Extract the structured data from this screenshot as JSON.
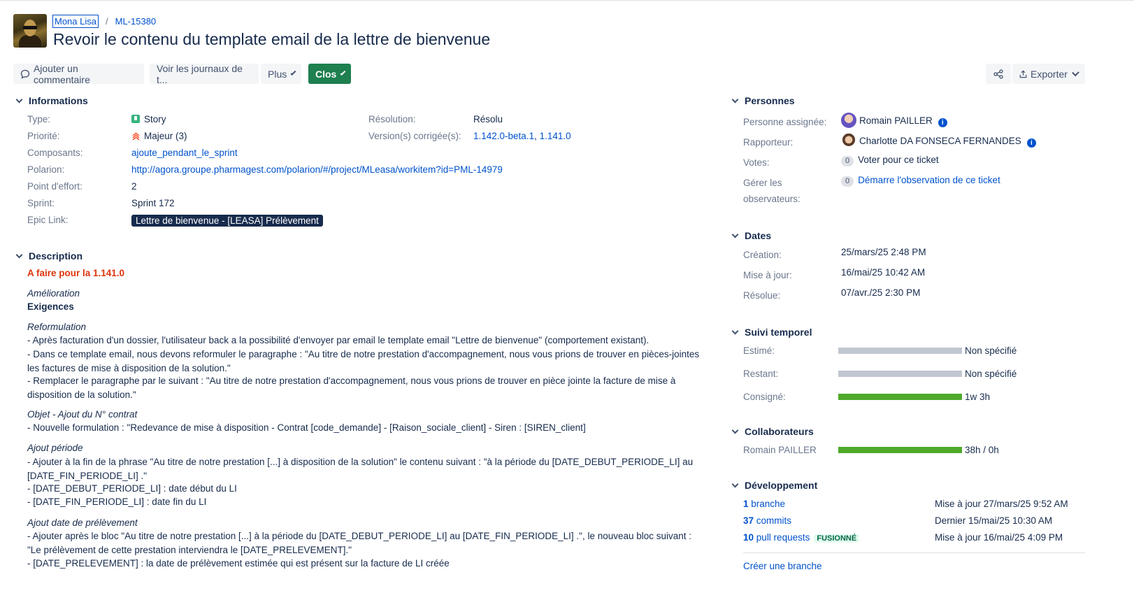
{
  "breadcrumb": {
    "project": "Mona Lisa",
    "separator": "/",
    "issue_key": "ML-15380"
  },
  "issue": {
    "title": "Revoir le contenu du template email de la lettre de bienvenue"
  },
  "toolbar": {
    "comment": "Ajouter un commentaire",
    "logs": "Voir les journaux de t...",
    "more": "Plus",
    "status": "Clos",
    "export": "Exporter"
  },
  "info": {
    "heading": "Informations",
    "type_label": "Type:",
    "type_value": "Story",
    "priority_label": "Priorité:",
    "priority_value": "Majeur (3)",
    "components_label": "Composants:",
    "components_value": "ajoute_pendant_le_sprint",
    "polarion_label": "Polarion:",
    "polarion_value": "http://agora.groupe.pharmagest.com/polarion/#/project/MLeasa/workitem?id=PML-14979",
    "points_label": "Point d'effort:",
    "points_value": "2",
    "sprint_label": "Sprint:",
    "sprint_value": "Sprint 172",
    "epic_label": "Epic Link:",
    "epic_value": "Lettre de bienvenue - [LEASA] Prélèvement",
    "resolution_label": "Résolution:",
    "resolution_value": "Résolu",
    "fixversion_label": "Version(s) corrigée(s):",
    "fixversion_1": "1.142.0-beta.1",
    "fixversion_sep": ",",
    "fixversion_2": "1.141.0"
  },
  "description": {
    "heading": "Description",
    "todo": "A faire pour la 1.141.0",
    "amelioration": "Amélioration",
    "exigences": "Exigences",
    "reform_title": "Reformulation",
    "reform_1": "- Après facturation d'un dossier, l'utilisateur back a la possibilité d'envoyer par email le template email \"Lettre de bienvenue\" (comportement existant).",
    "reform_2": "- Dans ce template email, nous devons reformuler le paragraphe : \"Au titre de notre prestation d'accompagnement, nous vous prions de trouver en pièces-jointes les factures de mise à disposition de la solution.\"",
    "reform_3": "- Remplacer le paragraphe par le suivant : \"Au titre de notre prestation d'accompagnement, nous vous prions de trouver en pièce jointe la facture de mise à disposition de la solution.\"",
    "objet_title": "Objet - Ajout du N° contrat",
    "objet_1": "- Nouvelle formulation : \"Redevance de mise à disposition - Contrat [code_demande] - [Raison_sociale_client] - Siren : [SIREN_client]",
    "periode_title": "Ajout période",
    "periode_1": "- Ajouter à la fin de la phrase \"Au titre de notre prestation [...] à disposition de la solution\" le contenu suivant : \"à la période du [DATE_DEBUT_PERIODE_LI] au [DATE_FIN_PERIODE_LI] .\"",
    "periode_2": "- [DATE_DEBUT_PERIODE_LI] : date début du LI",
    "periode_3": "- [DATE_FIN_PERIODE_LI] : date fin du LI",
    "prelev_title": "Ajout date de prélèvement",
    "prelev_1": "- Ajouter après le bloc \"Au titre de notre prestation [...] à la période du [DATE_DEBUT_PERIODE_LI] au [DATE_FIN_PERIODE_LI] .\", le nouveau bloc suivant : \"Le prélèvement de cette prestation interviendra le [DATE_PRELEVEMENT].\"",
    "prelev_2": "- [DATE_PRELEVEMENT] : la date de prélèvement estimée qui est présent sur la facture de LI créée"
  },
  "people": {
    "heading": "Personnes",
    "assignee_label": "Personne assignée:",
    "assignee": "Romain PAILLER",
    "reporter_label": "Rapporteur:",
    "reporter": "Charlotte DA FONSECA FERNANDES",
    "votes_label": "Votes:",
    "votes_count": "0",
    "votes_link": "Voter pour ce ticket",
    "watchers_label_1": "Gérer les",
    "watchers_label_2": "observateurs:",
    "watchers_count": "0",
    "watchers_link": "Démarre l'observation de ce ticket"
  },
  "dates": {
    "heading": "Dates",
    "created_label": "Création:",
    "created": "25/mars/25 2:48 PM",
    "updated_label": "Mise à jour:",
    "updated": "16/mai/25 10:42 AM",
    "resolved_label": "Résolue:",
    "resolved": "07/avr./25 2:30 PM"
  },
  "time": {
    "heading": "Suivi temporel",
    "estimated_label": "Estimé:",
    "estimated_value": "Non spécifié",
    "estimated_fraction": 0,
    "remaining_label": "Restant:",
    "remaining_value": "Non spécifié",
    "remaining_fraction": 0,
    "logged_label": "Consigné:",
    "logged_value": "1w 3h",
    "logged_fraction": 1
  },
  "collab": {
    "heading": "Collaborateurs",
    "name": "Romain PAILLER",
    "value": "38h / 0h",
    "fraction": 1
  },
  "dev": {
    "heading": "Développement",
    "branch_count": "1",
    "branch_label": "branche",
    "branch_meta": "Mise à jour 27/mars/25 9:52 AM",
    "commits_count": "37",
    "commits_label": "commits",
    "commits_meta": "Dernier 15/mai/25 10:30 AM",
    "pr_count": "10",
    "pr_label": "pull requests",
    "pr_badge": "FUSIONNÉ",
    "pr_meta": "Mise à jour 16/mai/25 4:09 PM",
    "create_branch": "Créer une branche"
  },
  "colors": {
    "primary": "#1e7f4f",
    "link": "#0052cc",
    "progress_done": "#4faa2c",
    "progress_empty": "#c1c7d0"
  }
}
